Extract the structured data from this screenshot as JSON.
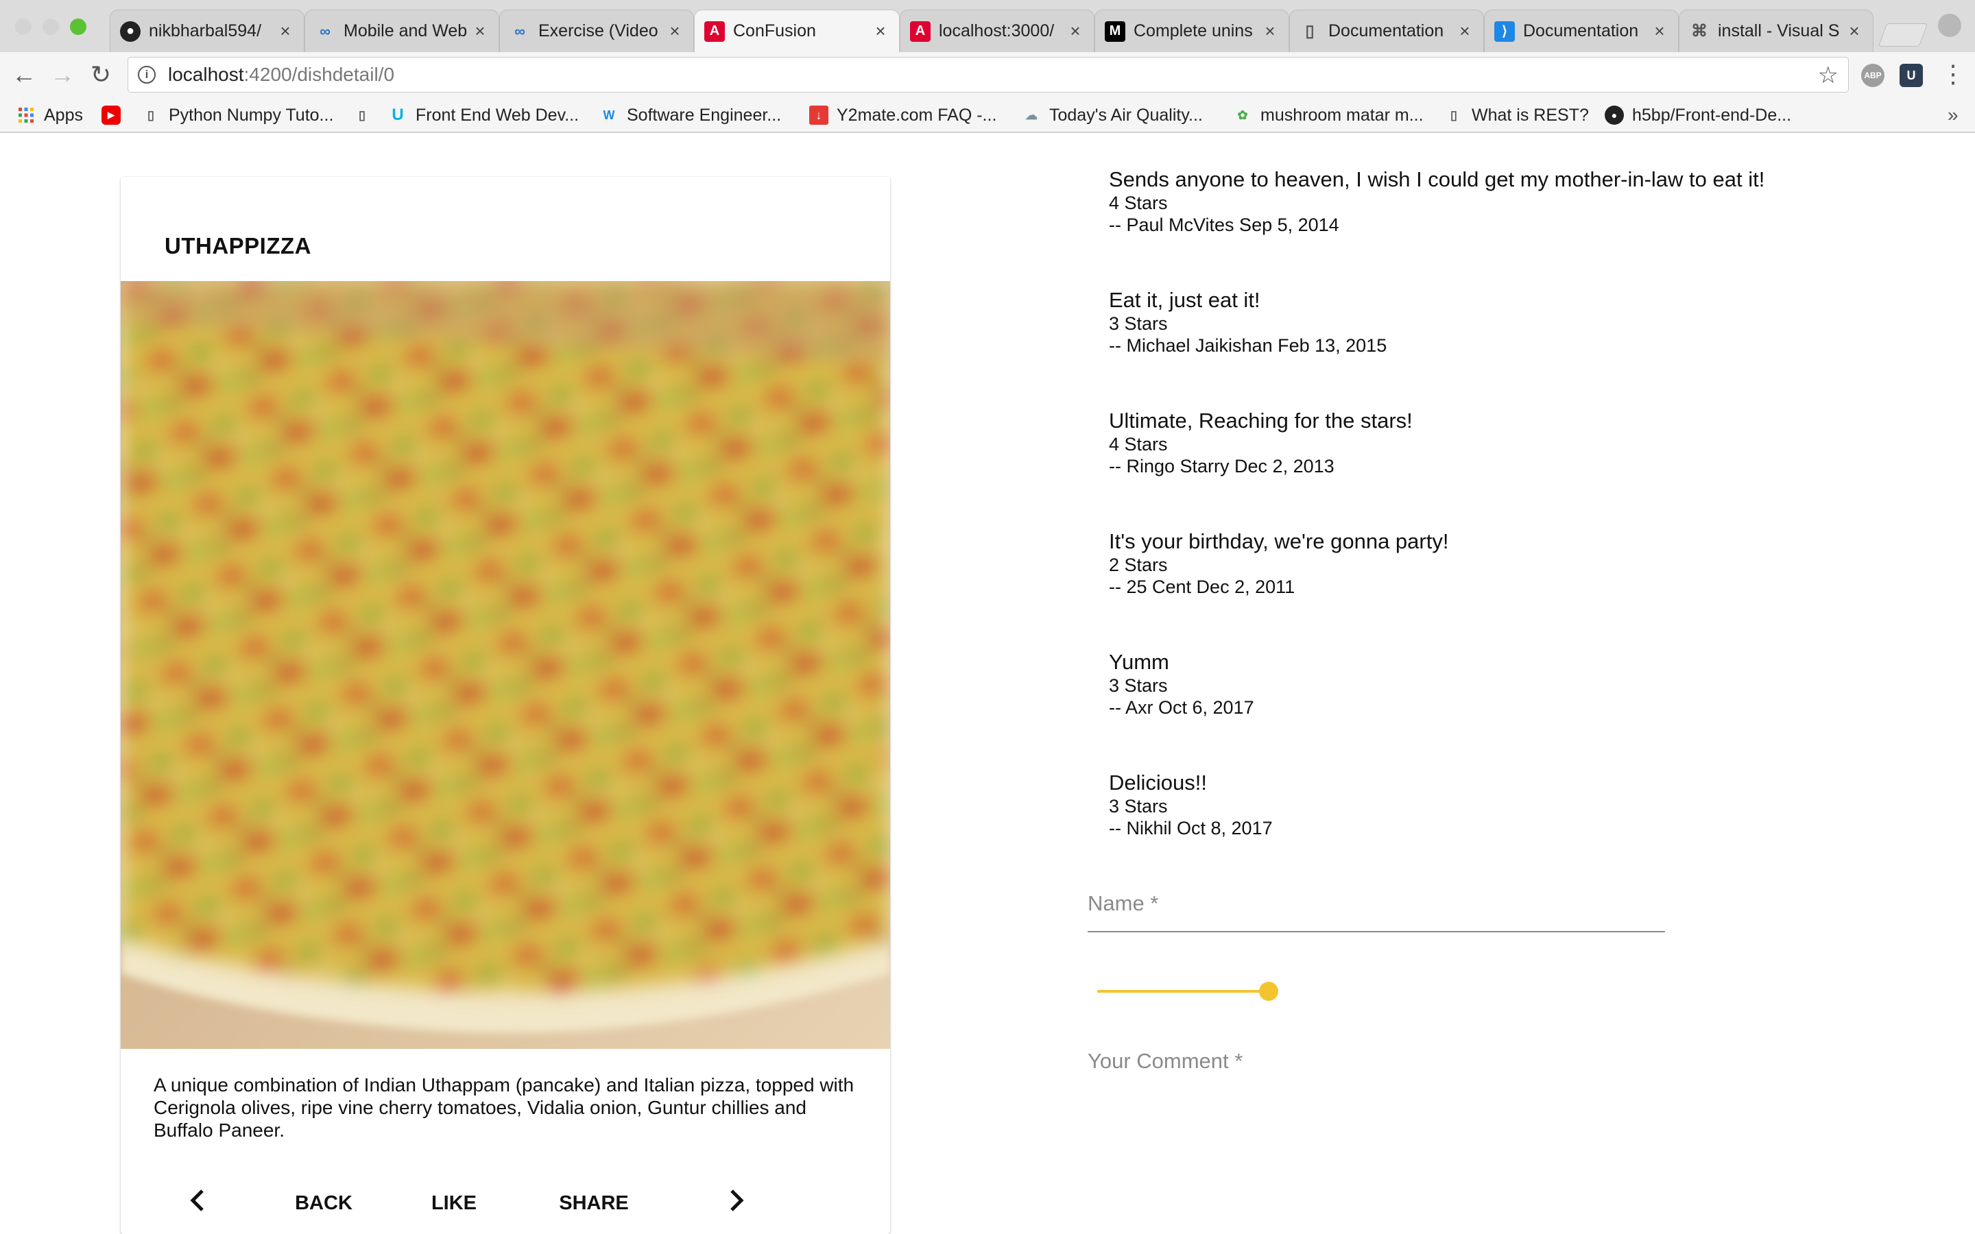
{
  "browser": {
    "tabs": [
      {
        "title": "nikbharbal594/",
        "icon": "github-icon",
        "active": false
      },
      {
        "title": "Mobile and Web",
        "icon": "coursera-icon",
        "active": false
      },
      {
        "title": "Exercise (Video",
        "icon": "coursera-icon",
        "active": false
      },
      {
        "title": "ConFusion",
        "icon": "angular-icon",
        "active": true
      },
      {
        "title": "localhost:3000/",
        "icon": "angular-icon",
        "active": false
      },
      {
        "title": "Complete unins",
        "icon": "medium-icon",
        "active": false
      },
      {
        "title": "Documentation",
        "icon": "document-icon",
        "active": false
      },
      {
        "title": "Documentation",
        "icon": "vscode-icon",
        "active": false
      },
      {
        "title": "install - Visual S",
        "icon": "command-icon",
        "active": false
      }
    ],
    "url_host": "localhost",
    "url_path": ":4200/dishdetail/0",
    "extensions": {
      "adblock": "ABP",
      "ext2": "U"
    },
    "bookmarks": [
      {
        "label": "Apps",
        "icon": "apps-grid-icon"
      },
      {
        "label": "",
        "icon": "youtube-icon"
      },
      {
        "label": "Python Numpy Tuto...",
        "icon": "document-icon"
      },
      {
        "label": "",
        "icon": "document-icon"
      },
      {
        "label": "Front End Web Dev...",
        "icon": "udacity-icon"
      },
      {
        "label": "Software Engineer...",
        "icon": "w-icon"
      },
      {
        "label": "Y2mate.com FAQ -...",
        "icon": "download-icon"
      },
      {
        "label": "Today's Air Quality...",
        "icon": "cloud-icon"
      },
      {
        "label": "mushroom matar m...",
        "icon": "leaf-icon"
      },
      {
        "label": "What is REST?",
        "icon": "document-icon"
      },
      {
        "label": "h5bp/Front-end-De...",
        "icon": "github-icon"
      }
    ]
  },
  "dish": {
    "name": "UTHAPPIZZA",
    "description": "A unique combination of Indian Uthappam (pancake) and Italian pizza, topped with Cerignola olives, ripe vine cherry tomatoes, Vidalia onion, Guntur chillies and Buffalo Paneer.",
    "actions": {
      "back": "BACK",
      "like": "LIKE",
      "share": "SHARE"
    }
  },
  "comments": [
    {
      "text": "Sends anyone to heaven, I wish I could get my mother-in-law to eat it!",
      "rating": "4 Stars",
      "byline": "-- Paul McVites Sep 5, 2014"
    },
    {
      "text": "Eat it, just eat it!",
      "rating": "3 Stars",
      "byline": "-- Michael Jaikishan Feb 13, 2015"
    },
    {
      "text": "Ultimate, Reaching for the stars!",
      "rating": "4 Stars",
      "byline": "-- Ringo Starry Dec 2, 2013"
    },
    {
      "text": "It's your birthday, we're gonna party!",
      "rating": "2 Stars",
      "byline": "-- 25 Cent Dec 2, 2011"
    },
    {
      "text": "Yumm",
      "rating": "3 Stars",
      "byline": "-- Axr Oct 6, 2017"
    },
    {
      "text": "Delicious!!",
      "rating": "3 Stars",
      "byline": "-- Nikhil Oct 8, 2017"
    }
  ],
  "form": {
    "name_placeholder": "Name *",
    "rating_value": 5,
    "rating_max": 5,
    "comment_placeholder": "Your Comment *"
  },
  "colors": {
    "accent": "#f4c430",
    "angular": "#dd0031"
  }
}
